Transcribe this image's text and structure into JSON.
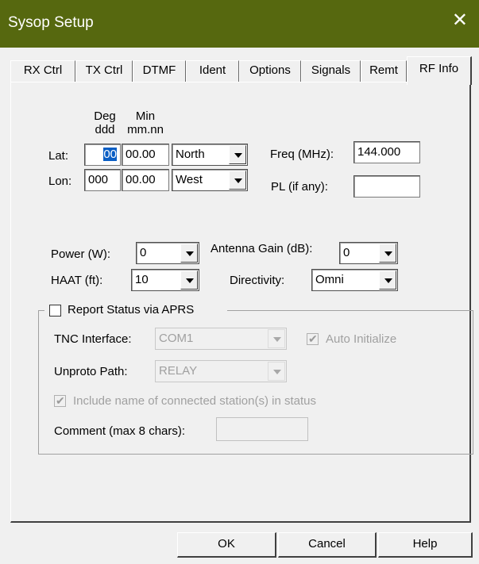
{
  "window": {
    "title": "Sysop Setup",
    "close_glyph": "✕"
  },
  "tabs": [
    {
      "label": "RX Ctrl"
    },
    {
      "label": "TX Ctrl"
    },
    {
      "label": "DTMF"
    },
    {
      "label": "Ident"
    },
    {
      "label": "Options"
    },
    {
      "label": "Signals"
    },
    {
      "label": "Remt"
    },
    {
      "label": "RF Info",
      "active": true
    }
  ],
  "rf_info": {
    "col_headers": {
      "deg": "Deg",
      "deg_fmt": "ddd",
      "min": "Min",
      "min_fmt": "mm.nn"
    },
    "lat": {
      "label": "Lat:",
      "deg": "00",
      "min": "00.00",
      "hemisphere": "North"
    },
    "lon": {
      "label": "Lon:",
      "deg": "000",
      "min": "00.00",
      "hemisphere": "West"
    },
    "freq": {
      "label": "Freq (MHz):",
      "value": "144.000"
    },
    "pl": {
      "label": "PL (if any):",
      "value": ""
    },
    "power": {
      "label": "Power (W):",
      "value": "0"
    },
    "antenna_gain": {
      "label": "Antenna Gain (dB):",
      "value": "0"
    },
    "haat": {
      "label": "HAAT (ft):",
      "value": "10"
    },
    "directivity": {
      "label": "Directivity:",
      "value": "Omni"
    }
  },
  "aprs": {
    "report_label": "Report Status via APRS",
    "report_checked": false,
    "tnc_label": "TNC Interface:",
    "tnc_value": "COM1",
    "auto_init_label": "Auto Initialize",
    "auto_init_checked": true,
    "unproto_label": "Unproto Path:",
    "unproto_value": "RELAY",
    "include_name_label": "Include name of connected station(s) in status",
    "include_name_checked": true,
    "comment_label": "Comment (max 8 chars):",
    "comment_value": ""
  },
  "buttons": {
    "ok": "OK",
    "cancel": "Cancel",
    "help": "Help"
  },
  "colors": {
    "titlebar": "#56680f",
    "selection": "#0a5ec4"
  }
}
